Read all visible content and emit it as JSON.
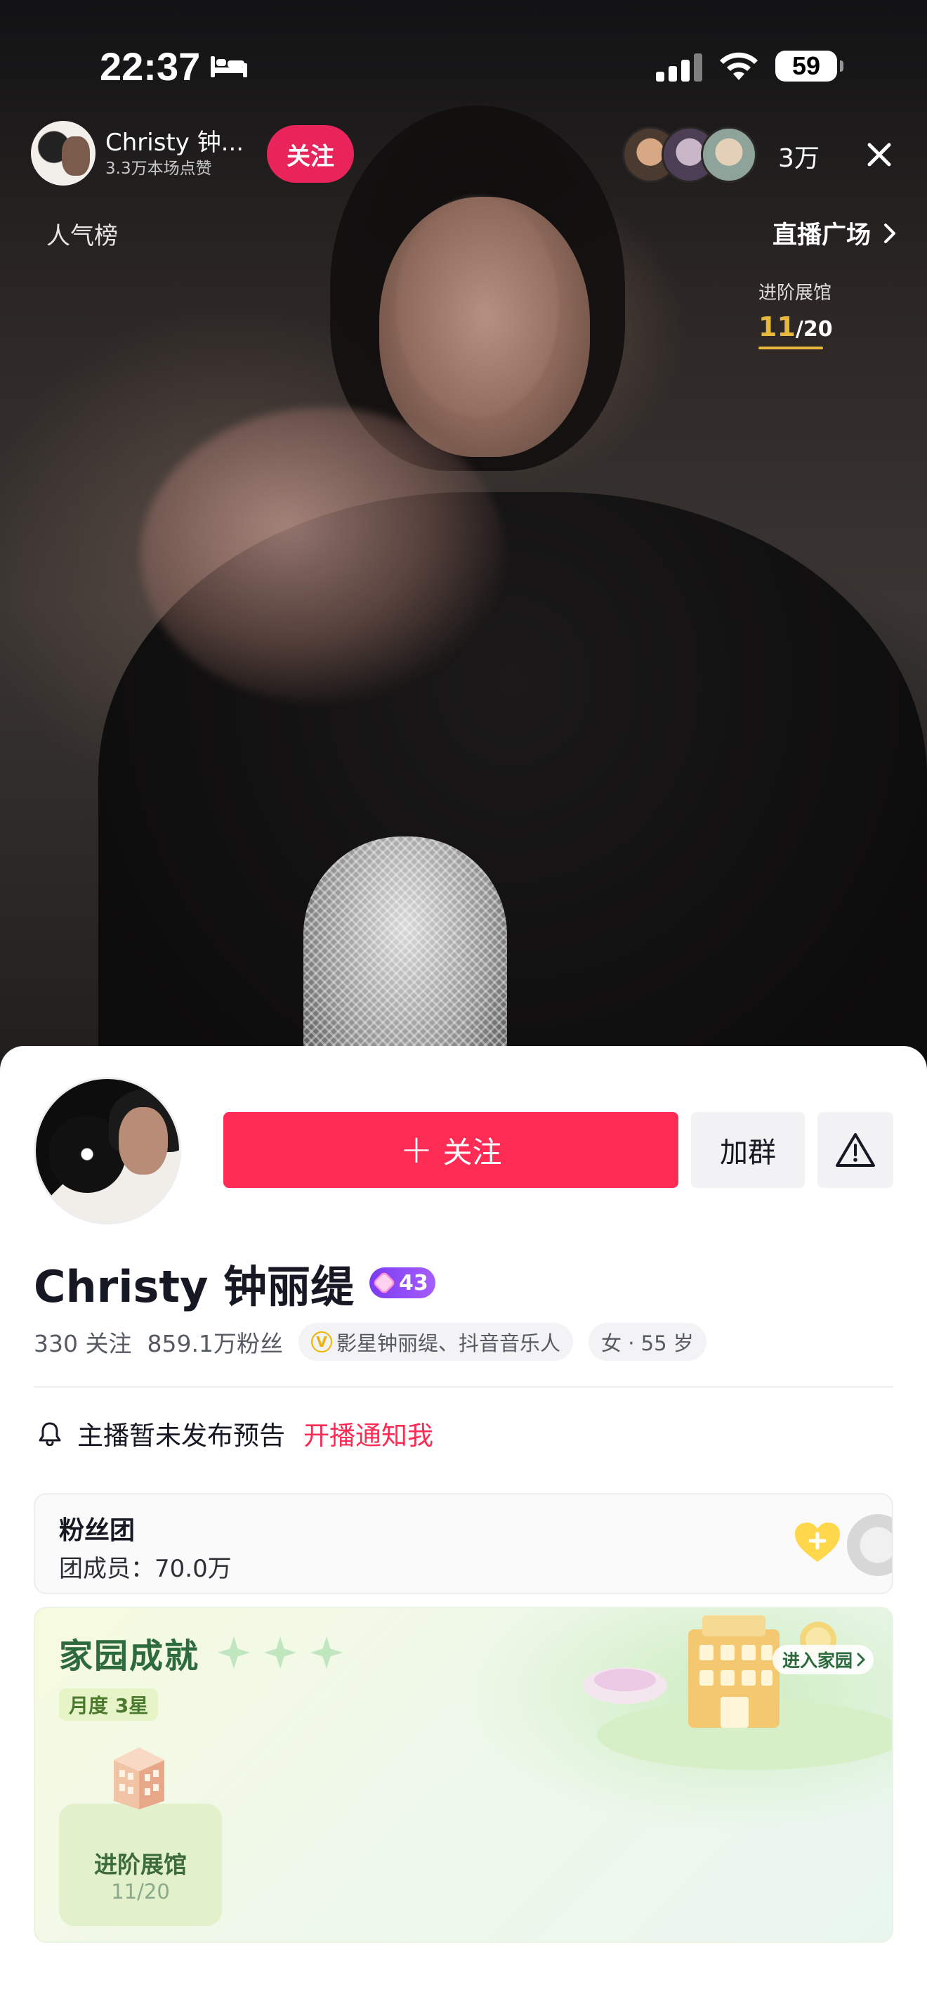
{
  "status_bar": {
    "time": "22:37",
    "battery": "59",
    "icons": [
      "bed-icon",
      "signal-icon",
      "wifi-icon",
      "battery-icon"
    ]
  },
  "live_header": {
    "host_name": "Christy 钟...",
    "host_likes": "3.3万本场点赞",
    "follow_label": "关注",
    "viewer_count": "3万",
    "rank_label": "人气榜",
    "plaza_label": "直播广场",
    "exhibit_label": "进阶展馆",
    "exhibit_progress_current": "11",
    "exhibit_progress_total": "/20"
  },
  "profile": {
    "follow_button": "关注",
    "group_button": "加群",
    "name": "Christy 钟丽缇",
    "level": "43",
    "following": "330 关注",
    "fans": "859.1万粉丝",
    "verify_tag": "影星钟丽缇、抖音音乐人",
    "gender_age": "女 · 55 岁"
  },
  "notice": {
    "text": "主播暂未发布预告",
    "action": "开播通知我"
  },
  "fan_club": {
    "title": "粉丝团",
    "members": "团成员：70.0万"
  },
  "home": {
    "title": "家园成就",
    "monthly": "月度 3星",
    "enter_label": "进入家园",
    "exhibit_name": "进阶展馆",
    "exhibit_progress": "11/20"
  },
  "colors": {
    "accent_red": "#fe2c55",
    "follow_pill": "#e8245b",
    "gold": "#e8b83a",
    "home_green": "#2d6a3e"
  }
}
